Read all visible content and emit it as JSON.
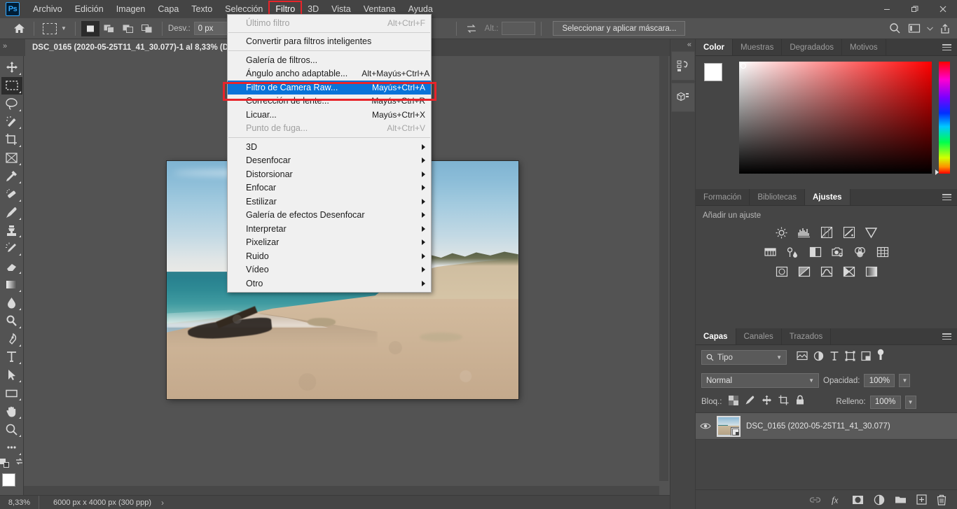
{
  "app": {
    "logo": "Ps",
    "accent": "#31a8ff",
    "highlight_color": "#0a73d8",
    "annotation_color": "#e8242a"
  },
  "menubar": {
    "items": [
      {
        "label": "Archivo"
      },
      {
        "label": "Edición"
      },
      {
        "label": "Imagen"
      },
      {
        "label": "Capa"
      },
      {
        "label": "Texto"
      },
      {
        "label": "Selección"
      },
      {
        "label": "Filtro",
        "highlighted": true
      },
      {
        "label": "3D"
      },
      {
        "label": "Vista"
      },
      {
        "label": "Ventana"
      },
      {
        "label": "Ayuda"
      }
    ],
    "window_controls": [
      "minimize-button",
      "restore-button",
      "close-button"
    ]
  },
  "options_bar": {
    "home_icon": "home-icon",
    "tool_preset": "marquee-tool-icon",
    "bool_modes": [
      "new-selection",
      "add-to-selection",
      "subtract-from-selection",
      "intersect-selection"
    ],
    "feather_label": "Desv.:",
    "feather_value": "0 px",
    "refine_icon": "refine-edge-icon",
    "alias_label": "Alt.:",
    "alias_value": "",
    "select_mask_button": "Seleccionar y aplicar máscara...",
    "right_icons": [
      "search-icon",
      "workspace-icon",
      "chevron-down-icon",
      "share-icon"
    ]
  },
  "document_tab": {
    "title": "DSC_0165 (2020-05-25T11_41_30.077)-1 al 8,33% (DS",
    "expand_icon": "double-chevron-right-icon"
  },
  "toolbar": {
    "tools": [
      {
        "name": "move-tool",
        "glyph": "move"
      },
      {
        "name": "rectangular-marquee-tool",
        "glyph": "marquee",
        "selected": true
      },
      {
        "name": "lasso-tool",
        "glyph": "lasso"
      },
      {
        "name": "quick-selection-tool",
        "glyph": "wand"
      },
      {
        "name": "crop-tool",
        "glyph": "crop"
      },
      {
        "name": "frame-tool",
        "glyph": "frame"
      },
      {
        "name": "eyedropper-tool",
        "glyph": "eyedropper"
      },
      {
        "name": "spot-healing-brush-tool",
        "glyph": "healing"
      },
      {
        "name": "brush-tool",
        "glyph": "brush"
      },
      {
        "name": "clone-stamp-tool",
        "glyph": "stamp"
      },
      {
        "name": "history-brush-tool",
        "glyph": "historybrush"
      },
      {
        "name": "eraser-tool",
        "glyph": "eraser"
      },
      {
        "name": "gradient-tool",
        "glyph": "gradient"
      },
      {
        "name": "blur-tool",
        "glyph": "blur"
      },
      {
        "name": "dodge-tool",
        "glyph": "dodge"
      },
      {
        "name": "pen-tool",
        "glyph": "pen"
      },
      {
        "name": "type-tool",
        "glyph": "type"
      },
      {
        "name": "path-selection-tool",
        "glyph": "pathselect"
      },
      {
        "name": "rectangle-tool",
        "glyph": "rectangle"
      },
      {
        "name": "hand-tool",
        "glyph": "hand"
      },
      {
        "name": "zoom-tool",
        "glyph": "zoom"
      },
      {
        "name": "edit-toolbar-button",
        "glyph": "ellipsis"
      }
    ],
    "foreground_color": "#ffffff",
    "background_color": "#1473c8"
  },
  "filter_menu": {
    "sections": [
      {
        "items": [
          {
            "label": "Último filtro",
            "shortcut": "Alt+Ctrl+F",
            "disabled": true
          }
        ]
      },
      {
        "items": [
          {
            "label": "Convertir para filtros inteligentes",
            "shortcut": "",
            "disabled": false
          }
        ]
      },
      {
        "items": [
          {
            "label": "Galería de filtros...",
            "shortcut": ""
          },
          {
            "label": "Ángulo ancho adaptable...",
            "shortcut": "Alt+Mayús+Ctrl+A"
          },
          {
            "label": "Filtro de Camera Raw...",
            "shortcut": "Mayús+Ctrl+A",
            "highlighted": true,
            "annotated": true
          },
          {
            "label": "Corrección de lente...",
            "shortcut": "Mayús+Ctrl+R"
          },
          {
            "label": "Licuar...",
            "shortcut": "Mayús+Ctrl+X"
          },
          {
            "label": "Punto de fuga...",
            "shortcut": "Alt+Ctrl+V",
            "disabled": true
          }
        ]
      },
      {
        "items": [
          {
            "label": "3D",
            "submenu": true
          },
          {
            "label": "Desenfocar",
            "submenu": true
          },
          {
            "label": "Distorsionar",
            "submenu": true
          },
          {
            "label": "Enfocar",
            "submenu": true
          },
          {
            "label": "Estilizar",
            "submenu": true
          },
          {
            "label": "Galería de efectos Desenfocar",
            "submenu": true
          },
          {
            "label": "Interpretar",
            "submenu": true
          },
          {
            "label": "Pixelizar",
            "submenu": true
          },
          {
            "label": "Ruido",
            "submenu": true
          },
          {
            "label": "Vídeo",
            "submenu": true
          },
          {
            "label": "Otro",
            "submenu": true
          }
        ]
      }
    ]
  },
  "rail": {
    "collapse_icon": "double-chevron-right-icon",
    "buttons": [
      {
        "name": "history-panel-icon"
      },
      {
        "name": "3d-panel-icon"
      }
    ]
  },
  "color_panel": {
    "tabs": [
      {
        "label": "Color",
        "selected": true
      },
      {
        "label": "Muestras",
        "selected": false
      },
      {
        "label": "Degradados",
        "selected": false
      },
      {
        "label": "Motivos",
        "selected": false
      }
    ],
    "menu_icon": "panel-menu-icon",
    "foreground": "#ffffff",
    "background": "#1473c8"
  },
  "adjust_panel": {
    "tabs": [
      {
        "label": "Formación",
        "selected": false
      },
      {
        "label": "Bibliotecas",
        "selected": false
      },
      {
        "label": "Ajustes",
        "selected": true
      }
    ],
    "menu_icon": "panel-menu-icon",
    "title": "Añadir un ajuste",
    "rows": [
      [
        "brightness-contrast-icon",
        "levels-icon",
        "curves-icon",
        "exposure-icon",
        "vibrance-icon"
      ],
      [
        "hue-saturation-icon",
        "color-balance-icon",
        "black-white-icon",
        "photo-filter-icon",
        "channel-mixer-icon",
        "color-lookup-icon"
      ],
      [
        "invert-icon",
        "posterize-icon",
        "threshold-icon",
        "gradient-map-icon",
        "selective-color-icon"
      ]
    ]
  },
  "layers_panel": {
    "tabs": [
      {
        "label": "Capas",
        "selected": true
      },
      {
        "label": "Canales",
        "selected": false
      },
      {
        "label": "Trazados",
        "selected": false
      }
    ],
    "menu_icon": "panel-menu-icon",
    "filter_label": "Tipo",
    "filter_icons": [
      "filter-pixel-icon",
      "filter-adjustment-icon",
      "filter-type-icon",
      "filter-shape-icon",
      "filter-smart-icon"
    ],
    "filter_toggle": "filter-enable-toggle",
    "blend_mode": "Normal",
    "opacity_label": "Opacidad:",
    "opacity_value": "100%",
    "lock_label": "Bloq.:",
    "lock_icons": [
      "lock-transparent-icon",
      "lock-image-icon",
      "lock-position-icon",
      "lock-artboard-icon",
      "lock-all-icon"
    ],
    "fill_label": "Relleno:",
    "fill_value": "100%",
    "layers": [
      {
        "name": "DSC_0165  (2020-05-25T11_41_30.077)",
        "visible": true,
        "smart_object": true,
        "selected": true
      }
    ],
    "bottom_icons": [
      {
        "name": "link-layers-icon",
        "glyph": "link",
        "dim": true
      },
      {
        "name": "layer-style-icon",
        "glyph": "fx",
        "dim": false
      },
      {
        "name": "layer-mask-icon",
        "glyph": "mask",
        "dim": false
      },
      {
        "name": "new-fill-adjustment-icon",
        "glyph": "adjust",
        "dim": false
      },
      {
        "name": "new-group-icon",
        "glyph": "folder",
        "dim": false
      },
      {
        "name": "new-layer-icon",
        "glyph": "newlayer",
        "dim": false
      },
      {
        "name": "delete-layer-icon",
        "glyph": "trash",
        "dim": false
      }
    ]
  },
  "status_bar": {
    "zoom": "8,33%",
    "doc_info": "6000 px x 4000 px (300 ppp)",
    "arrow_icon": "chevron-right-icon"
  },
  "canvas": {
    "image_description": "beach-photo",
    "zoom_level": "8,33%"
  }
}
